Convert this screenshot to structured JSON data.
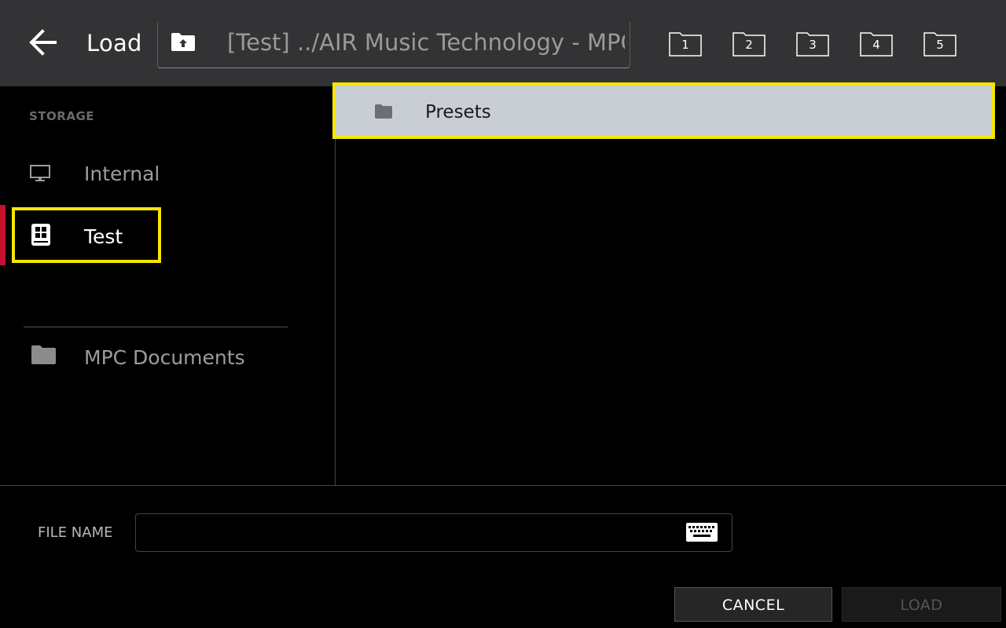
{
  "header": {
    "title": "Load",
    "path": "[Test] ../AIR Music Technology - MPC - ...",
    "favorites": [
      "1",
      "2",
      "3",
      "4",
      "5"
    ]
  },
  "sidebar": {
    "section_label": "STORAGE",
    "items": [
      {
        "label": "Internal",
        "icon": "monitor-icon"
      },
      {
        "label": "Test",
        "icon": "drive-icon",
        "selected": true
      },
      {
        "label": "MPC Documents",
        "icon": "folder-icon"
      }
    ]
  },
  "files": [
    {
      "name": "Presets",
      "type": "folder",
      "selected": true
    }
  ],
  "footer": {
    "file_name_label": "FILE NAME",
    "file_name_value": "",
    "cancel_label": "CANCEL",
    "load_label": "LOAD"
  },
  "colors": {
    "header_bg": "#333335",
    "highlight": "#f5e600",
    "accent": "#c8102e",
    "selected_row_bg": "#c8ced3"
  }
}
